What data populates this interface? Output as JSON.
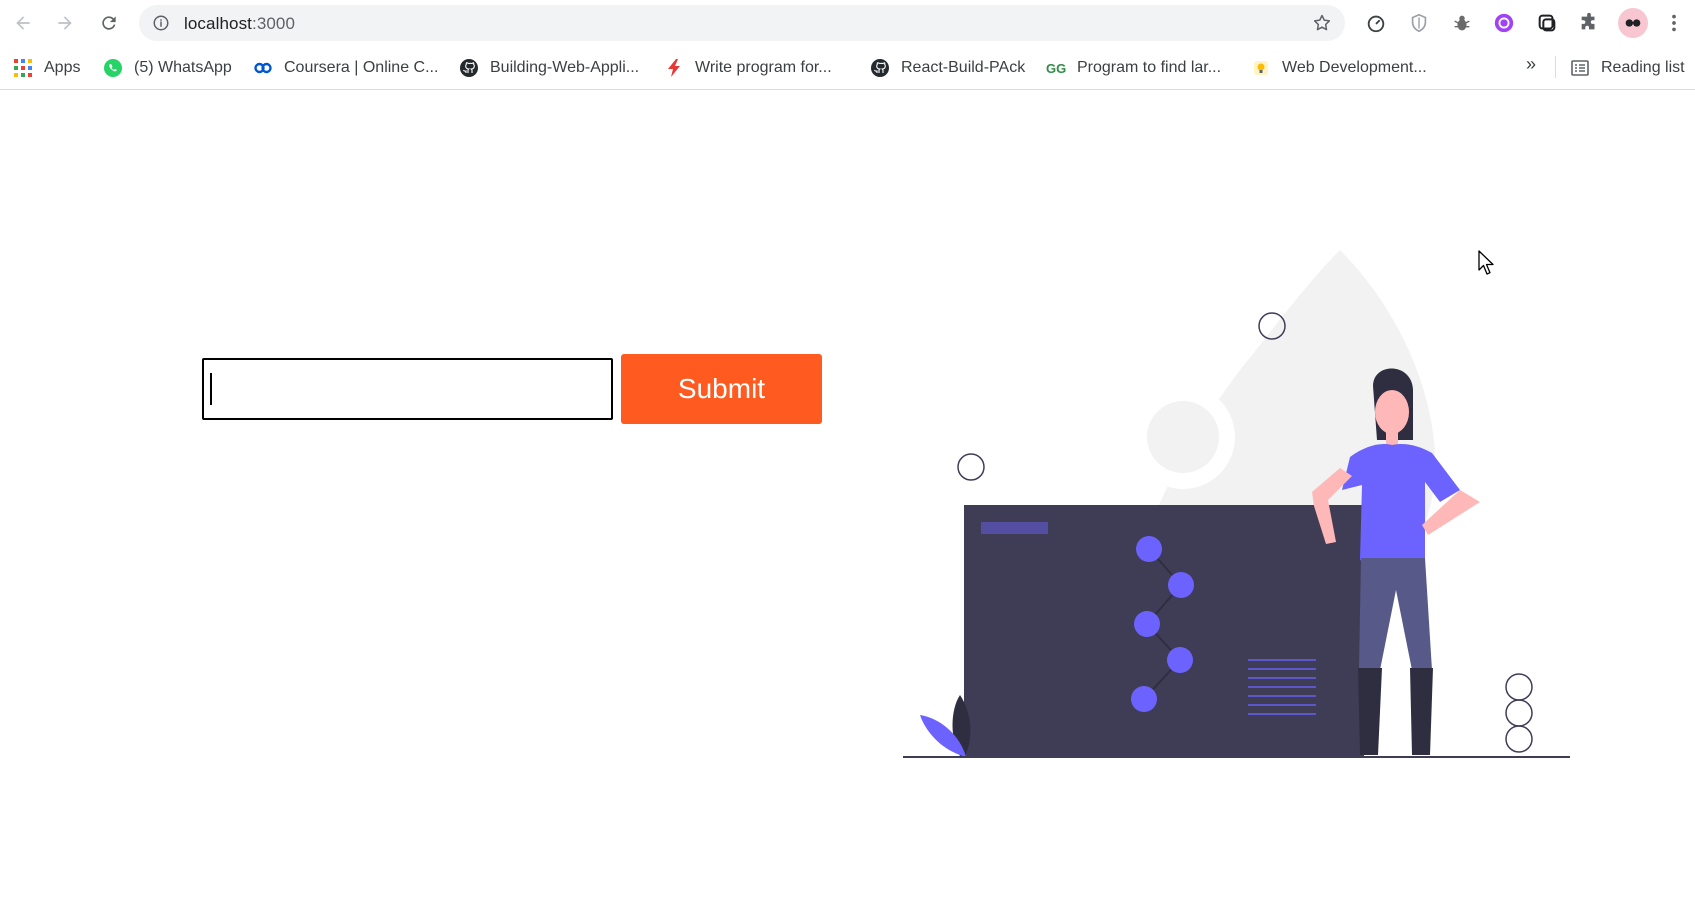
{
  "browser": {
    "url_host": "localhost",
    "url_port": ":3000"
  },
  "bookmarks": {
    "items": [
      {
        "label": "Apps",
        "icon": "apps-grid-icon"
      },
      {
        "label": "(5) WhatsApp",
        "icon": "whatsapp-icon"
      },
      {
        "label": "Coursera | Online C...",
        "icon": "coursera-icon"
      },
      {
        "label": "Building-Web-Appli...",
        "icon": "github-icon"
      },
      {
        "label": "Write program for...",
        "icon": "lightning-icon"
      },
      {
        "label": "React-Build-PAck",
        "icon": "github-icon"
      },
      {
        "label": "Program to find lar...",
        "icon": "geeksforgeeks-icon"
      },
      {
        "label": "Web Development...",
        "icon": "bulb-icon"
      }
    ],
    "overflow": "»",
    "reading_list": "Reading list"
  },
  "form": {
    "input_value": "",
    "submit_label": "Submit"
  },
  "colors": {
    "accent": "#ff5a1f",
    "illustration_dark": "#3f3d56",
    "illustration_purple": "#6c63ff",
    "illustration_gray": "#f2f2f2"
  }
}
